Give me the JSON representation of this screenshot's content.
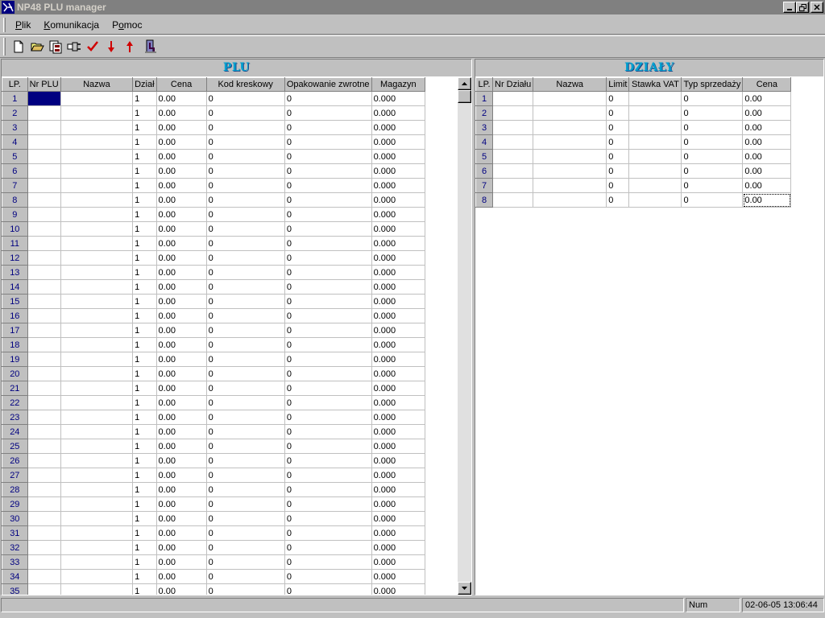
{
  "window": {
    "title": "NP48 PLU manager"
  },
  "menu": [
    {
      "prefix": "",
      "key": "P",
      "rest": "lik"
    },
    {
      "prefix": "",
      "key": "K",
      "rest": "omunikacja"
    },
    {
      "prefix": "P",
      "key": "o",
      "rest": "moc"
    }
  ],
  "toolbar": {
    "icons": [
      "new-file-icon",
      "open-folder-icon",
      "save-icon",
      "connect-plug-icon",
      "check-icon",
      "arrow-down-icon",
      "arrow-up-icon",
      "exit-door-icon"
    ]
  },
  "plu": {
    "title": "PLU",
    "columns": [
      "LP.",
      "Nr PLU",
      "Nazwa",
      "Dział",
      "Cena",
      "Kod kreskowy",
      "Opakowanie zwrotne",
      "Magazyn"
    ],
    "default_row": {
      "nr_plu": "",
      "nazwa": "",
      "dzial": "1",
      "cena": "0.00",
      "kod": "0",
      "opakowanie": "0",
      "magazyn": "0.000"
    },
    "row_count": 35
  },
  "dzialy": {
    "title": "DZIAŁY",
    "columns": [
      "LP.",
      "Nr Działu",
      "Nazwa",
      "Limit",
      "Stawka VAT",
      "Typ sprzedaży",
      "Cena"
    ],
    "default_row": {
      "nr_dzialu": "",
      "nazwa": "",
      "limit": "0",
      "stawka": "",
      "typ": "0",
      "cena": "0.00"
    },
    "row_count": 8
  },
  "status": {
    "message": "",
    "num": "Num",
    "datetime": "02-06-05 13:06:44"
  },
  "colors": {
    "selection": "#000080",
    "header_text": "#00a0d0",
    "title_bar": "#808080"
  }
}
